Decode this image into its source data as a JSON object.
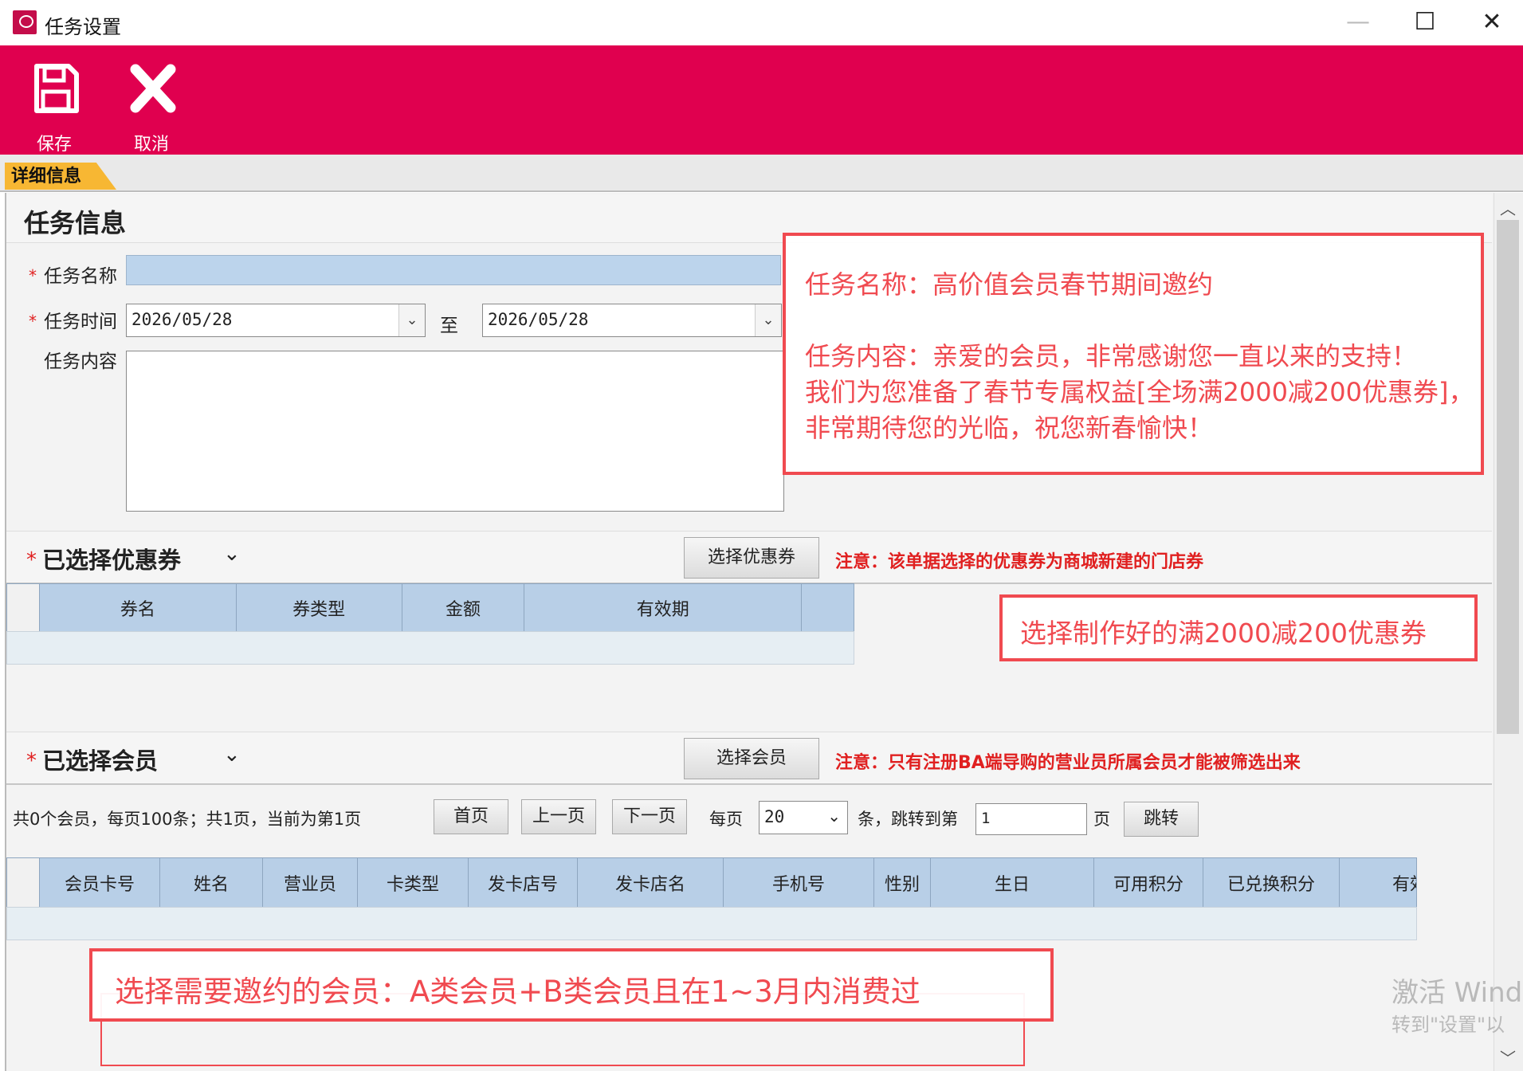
{
  "window": {
    "title": "任务设置",
    "minimize_glyph": "—",
    "maximize_glyph": "☐",
    "close_glyph": "✕"
  },
  "toolbar": {
    "save_label": "保存",
    "cancel_label": "取消",
    "accent_color": "#e0004f"
  },
  "tabs": [
    {
      "label": "详细信息",
      "active": true
    }
  ],
  "task_info": {
    "heading": "任务信息",
    "required_mark": "*",
    "name_label": "任务名称",
    "name_value": "",
    "time_label": "任务时间",
    "start_date": "2026/05/28",
    "to_label": "至",
    "end_date": "2026/05/28",
    "content_label": "任务内容",
    "content_value": ""
  },
  "annotation_task": {
    "line1": "任务名称：高价值会员春节期间邀约",
    "line2": "任务内容：亲爱的会员，非常感谢您一直以来的支持！",
    "line3": "我们为您准备了春节专属权益[全场满2000减200优惠券]，",
    "line4": "非常期待您的光临，祝您新春愉快！"
  },
  "coupon_section": {
    "title": "已选择优惠券",
    "select_button": "选择优惠券",
    "note": "注意：该单据选择的优惠券为商城新建的门店券",
    "columns": [
      "券名",
      "券类型",
      "金额",
      "有效期"
    ],
    "rows": []
  },
  "annotation_coupon": "选择制作好的满2000减200优惠券",
  "member_section": {
    "title": "已选择会员",
    "select_button": "选择会员",
    "note": "注意：只有注册BA端导购的营业员所属会员才能被筛选出来",
    "pager": {
      "summary": "共0个会员，每页100条；共1页，当前为第1页",
      "first": "首页",
      "prev": "上一页",
      "next": "下一页",
      "per_page_label": "每页",
      "per_page_value": "20",
      "jump_label": "条，跳转到第",
      "page_input": "1",
      "page_suffix": "页",
      "jump_button": "跳转"
    },
    "columns": [
      "会员卡号",
      "姓名",
      "营业员",
      "卡类型",
      "发卡店号",
      "发卡店名",
      "手机号",
      "性别",
      "生日",
      "可用积分",
      "已兑换积分",
      "有效"
    ],
    "rows": []
  },
  "annotation_member": "选择需要邀约的会员：A类会员+B类会员且在1~3月内消费过",
  "watermark": {
    "line1": "激活 Wind",
    "line2": "转到\"设置\"以"
  },
  "icons": [
    "app-logo-icon",
    "save-icon",
    "close-x-icon",
    "chevron-down-icon",
    "dropdown-arrow-icon",
    "scroll-up-icon",
    "scroll-down-icon"
  ]
}
